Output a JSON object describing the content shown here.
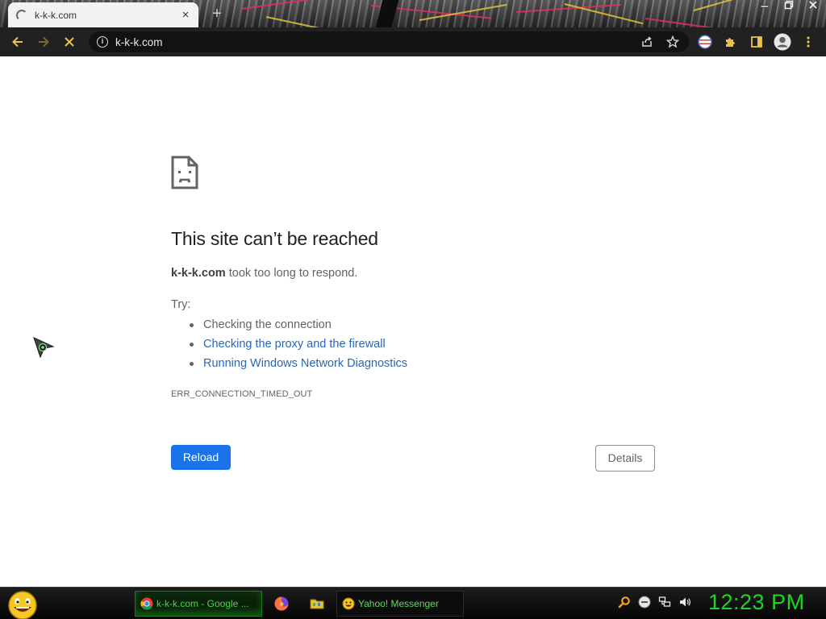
{
  "browser": {
    "tab": {
      "title": "k-k-k.com",
      "close_glyph": "×"
    },
    "new_tab_glyph": "+",
    "omnibox": {
      "url": "k-k-k.com"
    }
  },
  "error_page": {
    "heading": "This site can’t be reached",
    "host": "k-k-k.com",
    "description": " took too long to respond.",
    "try_label": "Try:",
    "suggestions": [
      {
        "text": "Checking the connection",
        "link": false
      },
      {
        "text": "Checking the proxy and the firewall",
        "link": true
      },
      {
        "text": "Running Windows Network Diagnostics",
        "link": true
      }
    ],
    "error_code": "ERR_CONNECTION_TIMED_OUT",
    "reload_label": "Reload",
    "details_label": "Details"
  },
  "taskbar": {
    "tasks": [
      {
        "label": "k-k-k.com - Google ...",
        "icon": "chrome-icon",
        "active": true
      },
      {
        "label": "Yahoo! Messenger",
        "icon": "yahoo-messenger-icon",
        "active": false
      }
    ],
    "quick_launch": [
      "firefox-icon",
      "folder-icon"
    ],
    "tray": [
      "search-icon",
      "minus-circle-icon",
      "network-icon",
      "volume-icon"
    ],
    "clock": "12:23 PM"
  },
  "colors": {
    "toolbar_bg": "#212121",
    "link": "#2a66b5",
    "reload_button": "#1a73e8",
    "clock": "#1fd61f"
  }
}
